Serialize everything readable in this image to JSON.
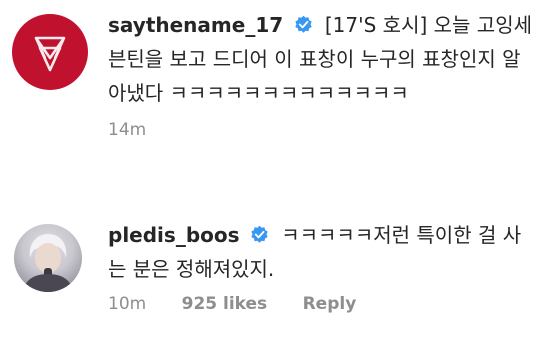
{
  "comments": [
    {
      "username": "saythename_17",
      "text": "[17'S 호시] 오늘 고잉세븐틴을 보고 드디어 이 표창이 누구의 표창인지 알아냈다 ㅋㅋㅋㅋㅋㅋㅋㅋㅋㅋㅋㅋㅋ",
      "time": "14m",
      "avatar_icon": "seventeen-logo-icon",
      "colors": {
        "avatar_bg": "#c0122f"
      }
    },
    {
      "username": "pledis_boos",
      "text": "ㅋㅋㅋㅋㅋ저런 특이한 걸 사는 분은 정해져있지.",
      "time": "10m",
      "likes": "925 likes",
      "reply": "Reply",
      "avatar_icon": "profile-photo-icon"
    }
  ],
  "colors": {
    "verified_badge": "#3897f0",
    "meta_text": "#8e8e8e",
    "body_text": "#262626"
  }
}
